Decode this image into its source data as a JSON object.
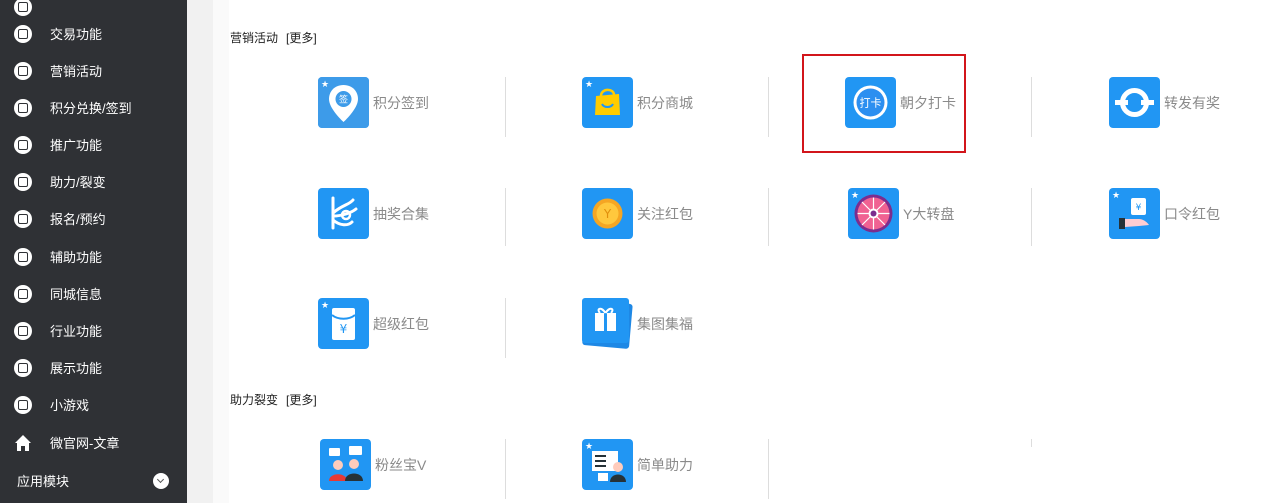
{
  "sidebar": {
    "items": [
      {
        "label": "交易功能"
      },
      {
        "label": "营销活动"
      },
      {
        "label": "积分兑换/签到"
      },
      {
        "label": "推广功能"
      },
      {
        "label": "助力/裂变"
      },
      {
        "label": "报名/预约"
      },
      {
        "label": "辅助功能"
      },
      {
        "label": "同城信息"
      },
      {
        "label": "行业功能"
      },
      {
        "label": "展示功能"
      },
      {
        "label": "小游戏"
      }
    ],
    "home_item": {
      "label": "微官网-文章"
    },
    "module": {
      "label": "应用模块"
    }
  },
  "sections": [
    {
      "title": "营销活动",
      "more": "[更多]",
      "tiles": [
        {
          "label": "积分签到",
          "icon": "checkin-pin-icon"
        },
        {
          "label": "积分商城",
          "icon": "shopping-bag-icon"
        },
        {
          "label": "朝夕打卡",
          "icon": "punch-card-icon"
        },
        {
          "label": "转发有奖",
          "icon": "share-icon"
        },
        {
          "label": "抽奖合集",
          "icon": "lottery-hand-icon"
        },
        {
          "label": "关注红包",
          "icon": "coin-icon"
        },
        {
          "label": "Y大转盘",
          "icon": "wheel-icon"
        },
        {
          "label": "口令红包",
          "icon": "red-packet-hand-icon"
        },
        {
          "label": "超级红包",
          "icon": "red-packet-icon"
        },
        {
          "label": "集图集福",
          "icon": "gift-card-icon"
        }
      ]
    },
    {
      "title": "助力裂变",
      "more": "[更多]",
      "tiles": [
        {
          "label": "粉丝宝V",
          "icon": "fans-icon"
        },
        {
          "label": "简单助力",
          "icon": "assist-icon"
        }
      ]
    }
  ],
  "colors": {
    "sidebar_bg": "#2f3135",
    "icon_blue": "#2196f3",
    "highlight": "#d2151b"
  }
}
